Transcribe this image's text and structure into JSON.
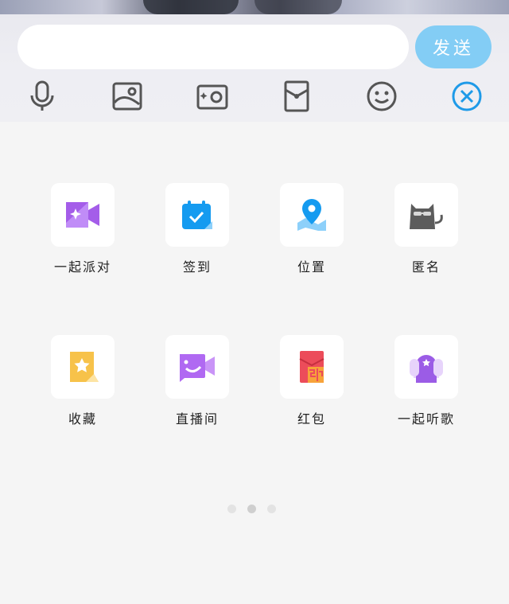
{
  "composer": {
    "input_value": "",
    "input_placeholder": "",
    "send_label": "发送"
  },
  "toolbar": {
    "tools": [
      {
        "name": "microphone-icon"
      },
      {
        "name": "image-icon"
      },
      {
        "name": "camera-icon"
      },
      {
        "name": "red-packet-icon"
      },
      {
        "name": "emoji-icon"
      },
      {
        "name": "close-icon",
        "color": "#1e9ae8"
      }
    ]
  },
  "features": [
    {
      "label": "一起派对",
      "icon": "party-video-icon"
    },
    {
      "label": "签到",
      "icon": "checkin-calendar-icon"
    },
    {
      "label": "位置",
      "icon": "location-icon"
    },
    {
      "label": "匿名",
      "icon": "anonymous-cat-icon"
    },
    {
      "label": "收藏",
      "icon": "favorite-star-icon"
    },
    {
      "label": "直播间",
      "icon": "live-room-icon"
    },
    {
      "label": "红包",
      "icon": "red-packet-icon"
    },
    {
      "label": "一起听歌",
      "icon": "listen-together-icon"
    }
  ],
  "pager": {
    "count": 3,
    "active_index": 1
  },
  "colors": {
    "send_button": "#83cdf5",
    "accent_blue": "#1e9ae8",
    "purple": "#a85ff0",
    "yellow": "#f7c24a",
    "red": "#ec4c5a",
    "toolbar_icon": "#555555"
  }
}
